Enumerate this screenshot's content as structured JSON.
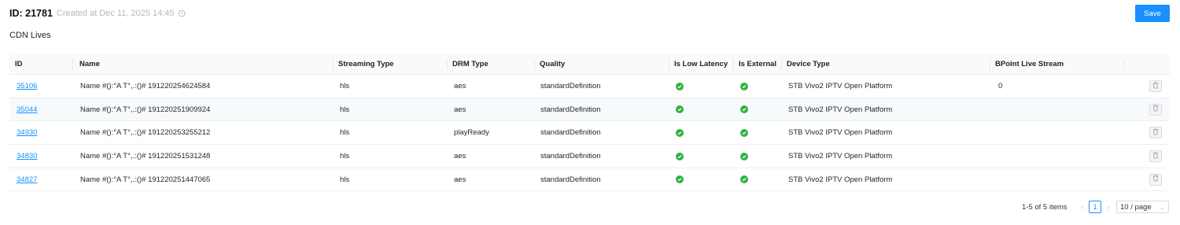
{
  "header": {
    "id_label": "ID: 21781",
    "created": "Created at Dec 11, 2025 14:45"
  },
  "save_label": "Save",
  "section_title": "CDN Lives",
  "table": {
    "columns": [
      "ID",
      "Name",
      "Streaming Type",
      "DRM Type",
      "Quality",
      "Is Low Latency",
      "Is External",
      "Device Type",
      "BPoint Live Stream"
    ],
    "rows": [
      {
        "id": "35106",
        "name": "Name #():°A T°,.:()# 191220254624584",
        "streaming": "hls",
        "drm": "aes",
        "quality": "standardDefinition",
        "low_latency": true,
        "external": true,
        "device": "STB Vivo2 IPTV Open Platform",
        "bpoint": "0"
      },
      {
        "id": "35044",
        "name": "Name #():°A T°,.:()# 191220251909924",
        "streaming": "hls",
        "drm": "aes",
        "quality": "standardDefinition",
        "low_latency": true,
        "external": true,
        "device": "STB Vivo2 IPTV Open Platform",
        "bpoint": ""
      },
      {
        "id": "34930",
        "name": "Name #():°A T°,.:()# 191220253255212",
        "streaming": "hls",
        "drm": "playReady",
        "quality": "standardDefinition",
        "low_latency": true,
        "external": true,
        "device": "STB Vivo2 IPTV Open Platform",
        "bpoint": ""
      },
      {
        "id": "34830",
        "name": "Name #():°A T°,.:()# 191220251531248",
        "streaming": "hls",
        "drm": "aes",
        "quality": "standardDefinition",
        "low_latency": true,
        "external": true,
        "device": "STB Vivo2 IPTV Open Platform",
        "bpoint": ""
      },
      {
        "id": "34827",
        "name": "Name #():°A T°,.:()# 191220251447065",
        "streaming": "hls",
        "drm": "aes",
        "quality": "standardDefinition",
        "low_latency": true,
        "external": true,
        "device": "STB Vivo2 IPTV Open Platform",
        "bpoint": ""
      }
    ]
  },
  "pagination": {
    "total": "1-5 of 5 items",
    "current_page": "1",
    "page_size": "10 / page"
  },
  "colors": {
    "accent": "#1890ff",
    "check": "#2fb344"
  },
  "icons": {
    "clock": "clock-icon",
    "check": "check-circle-icon",
    "delete": "trash-icon",
    "prev": "chevron-left-icon",
    "next": "chevron-right-icon",
    "dropdown": "chevron-down-icon"
  }
}
